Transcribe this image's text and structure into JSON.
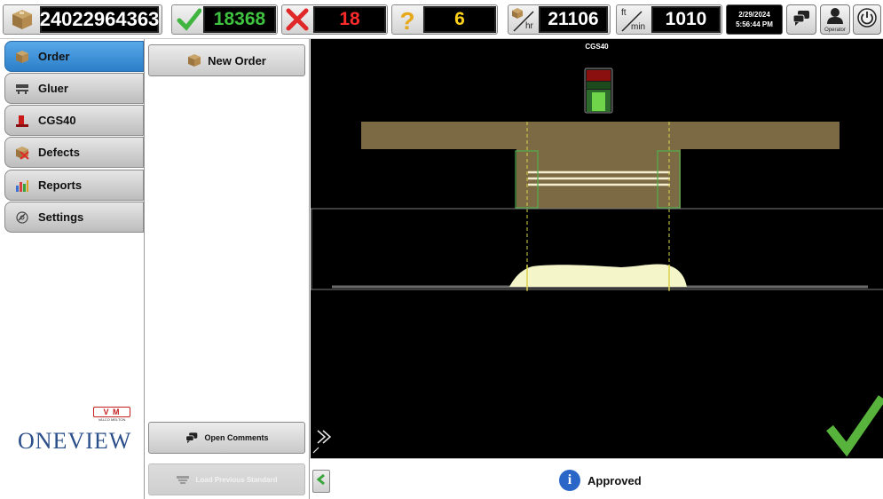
{
  "topbar": {
    "order_number": "24022964363",
    "good_count": "18368",
    "reject_count": "18",
    "unknown_count": "6",
    "rate_per_hour": "21106",
    "rate_per_hour_unit": "hr",
    "speed": "1010",
    "speed_unit_top": "ft",
    "speed_unit_bottom": "min",
    "date": "2/29/2024",
    "time": "5:56:44 PM",
    "operator_label": "Operator",
    "colors": {
      "good": "#3fc23f",
      "reject": "#ff2a2a",
      "unknown": "#ffd21a"
    }
  },
  "sidebar": {
    "items": [
      {
        "label": "Order",
        "icon": "box-icon",
        "active": true
      },
      {
        "label": "Gluer",
        "icon": "gluer-icon",
        "active": false
      },
      {
        "label": "CGS40",
        "icon": "cgs40-icon",
        "active": false
      },
      {
        "label": "Defects",
        "icon": "defects-icon",
        "active": false
      },
      {
        "label": "Reports",
        "icon": "bar-chart-icon",
        "active": false
      },
      {
        "label": "Settings",
        "icon": "settings-icon",
        "active": false
      }
    ],
    "logo_vm": "V  M",
    "logo_vm_sub": "VALCO MELTON",
    "brand": "ONEVIEW",
    "accent": "#3a8fd6"
  },
  "midpanel": {
    "new_order_label": "New Order",
    "open_comments_label": "Open Comments",
    "load_previous_label": "Load Previous Standard"
  },
  "viewer": {
    "title": "CGS40",
    "colors": {
      "background": "#000000",
      "carton": "#7b6a43",
      "glue_profile": "#f4f5c8",
      "guide_line": "#d9d24a",
      "window": "#52b04d",
      "indicator_good": "#6fd44a",
      "indicator_bad": "#8a0f0f"
    }
  },
  "status": {
    "message": "Approved",
    "icon": "info-icon",
    "result_icon": "checkmark-icon"
  }
}
